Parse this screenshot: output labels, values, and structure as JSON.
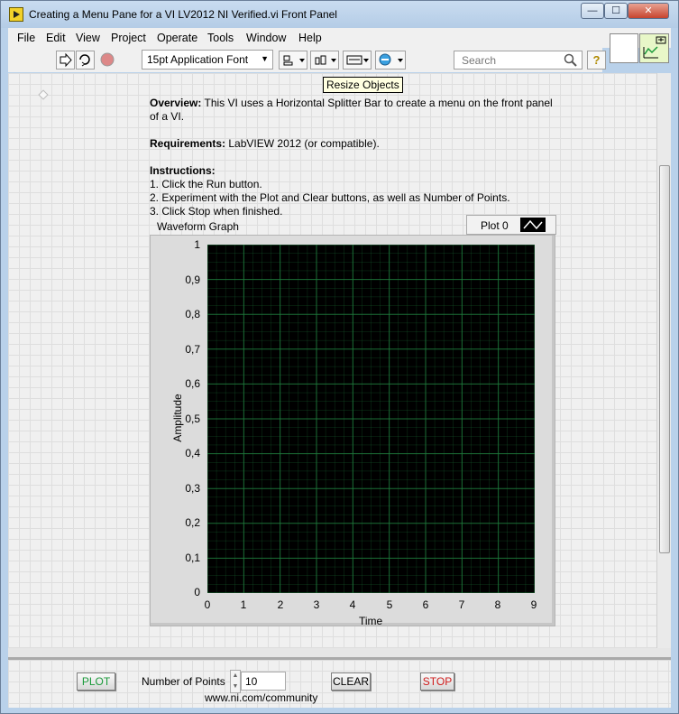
{
  "window": {
    "title": "Creating a Menu Pane for a VI LV2012 NI Verified.vi Front Panel",
    "min_glyph": "—",
    "max_glyph": "☐",
    "close_glyph": "✕"
  },
  "menu": [
    "File",
    "Edit",
    "View",
    "Project",
    "Operate",
    "Tools",
    "Window",
    "Help"
  ],
  "toolbar": {
    "font": "15pt Application Font",
    "search_placeholder": "Search",
    "help": "?"
  },
  "tooltip": "Resize Objects",
  "doc": {
    "overview_label": "Overview:",
    "overview_text": " This VI uses a Horizontal Splitter Bar to create a menu on the front panel of a VI.",
    "requirements_label": "Requirements:",
    "requirements_text": " LabVIEW 2012 (or compatible).",
    "instructions_label": "Instructions:",
    "steps": [
      "1. Click the Run button.",
      "2. Experiment with the Plot and Clear buttons, as well as Number of Points.",
      "3. Click Stop when finished."
    ]
  },
  "graph": {
    "label": "Waveform Graph",
    "legend": "Plot 0",
    "xlabel": "Time",
    "ylabel": "Amplitude",
    "yticks": [
      "1",
      "0,9",
      "0,8",
      "0,7",
      "0,6",
      "0,5",
      "0,4",
      "0,3",
      "0,2",
      "0,1",
      "0"
    ],
    "xticks": [
      "0",
      "1",
      "2",
      "3",
      "4",
      "5",
      "6",
      "7",
      "8",
      "9"
    ],
    "grid_color": "#1f7a3c",
    "plot_bg": "#000000"
  },
  "chart_data": {
    "type": "line",
    "title": "Waveform Graph",
    "xlabel": "Time",
    "ylabel": "Amplitude",
    "xlim": [
      0,
      9
    ],
    "ylim": [
      0,
      1
    ],
    "grid": true,
    "series": [
      {
        "name": "Plot 0",
        "x": [],
        "y": []
      }
    ]
  },
  "controls": {
    "plot": "PLOT",
    "num_points_label": "Number of Points",
    "num_points_value": "10",
    "clear": "CLEAR",
    "stop": "STOP",
    "community": "www.ni.com/community",
    "plot_color": "#1a9a3a",
    "stop_color": "#d01c1c"
  }
}
